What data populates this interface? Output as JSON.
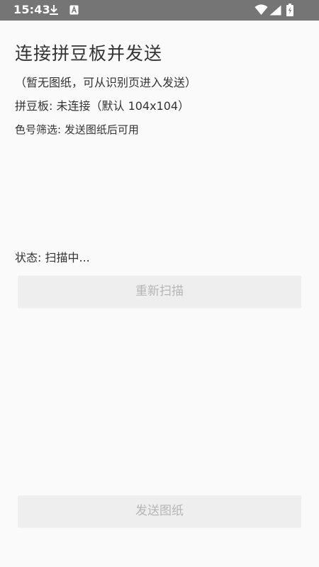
{
  "status_bar": {
    "time": "15:43",
    "background": "#757575",
    "icons": [
      "download-icon",
      "keyboard-icon",
      "wifi-icon",
      "signal-icon",
      "battery-charging-icon"
    ]
  },
  "page": {
    "title": "连接拼豆板并发送",
    "hint": "（暂无图纸，可从识别页进入发送）",
    "board_status": "拼豆板: 未连接（默认 104x104）",
    "color_filter": "色号筛选: 发送图纸后可用",
    "scan_status": "状态: 扫描中..."
  },
  "buttons": {
    "rescan_label": "重新扫描",
    "send_label": "发送图纸"
  },
  "colors": {
    "background": "#fafafa",
    "button_bg": "#eeeeee",
    "button_text_disabled": "#b5b5b5"
  }
}
